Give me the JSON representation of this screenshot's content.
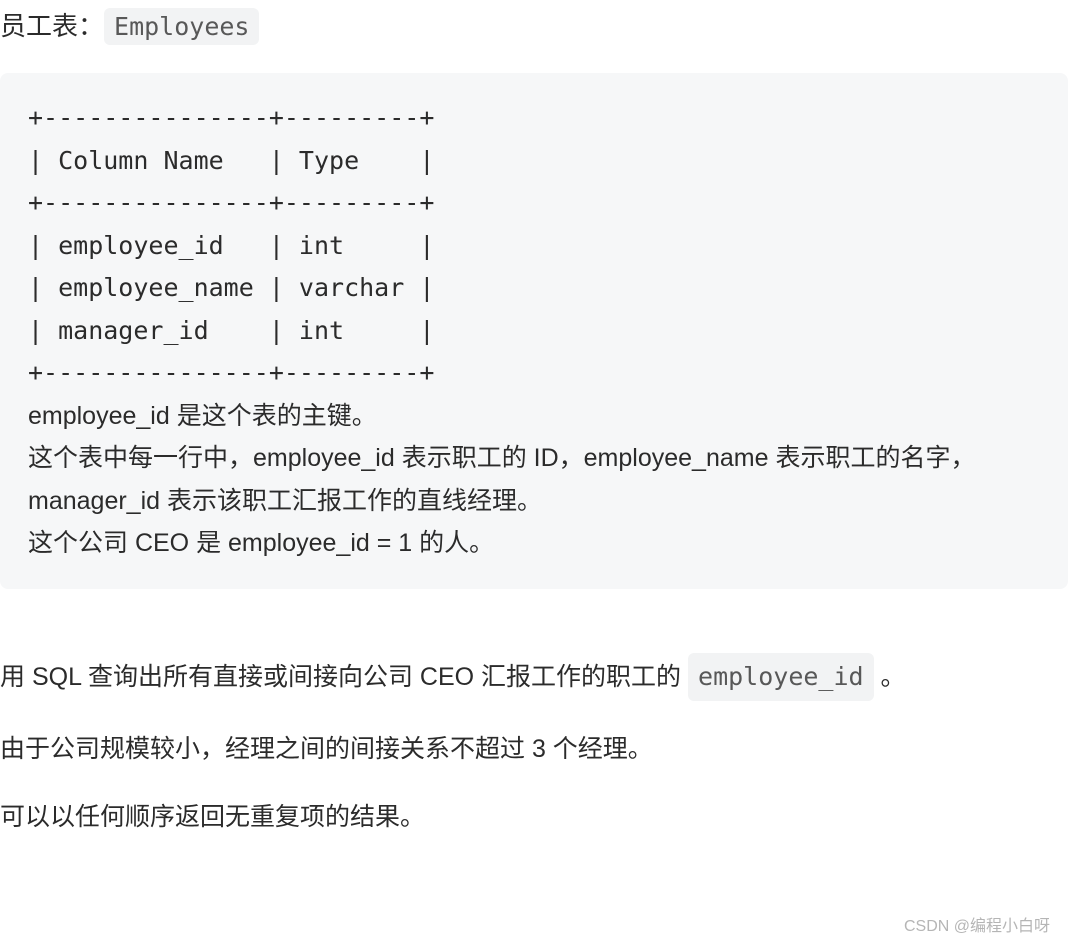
{
  "header": {
    "prefix": "员工表：",
    "table_name": "Employees"
  },
  "schema": {
    "ascii_table": "+---------------+---------+\n| Column Name   | Type    |\n+---------------+---------+\n| employee_id   | int     |\n| employee_name | varchar |\n| manager_id    | int     |\n+---------------+---------+",
    "desc_line1": "employee_id 是这个表的主键。",
    "desc_line2": "这个表中每一行中，employee_id 表示职工的 ID，employee_name 表示职工的名字，manager_id 表示该职工汇报工作的直线经理。",
    "desc_line3": "这个公司 CEO 是 employee_id = 1 的人。"
  },
  "question": {
    "p1_prefix": "用 SQL 查询出所有直接或间接向公司 CEO 汇报工作的职工的 ",
    "p1_code": "employee_id",
    "p1_suffix": " 。",
    "p2": "由于公司规模较小，经理之间的间接关系不超过 3 个经理。",
    "p3": "可以以任何顺序返回无重复项的结果。"
  },
  "watermark": "CSDN @编程小白呀"
}
